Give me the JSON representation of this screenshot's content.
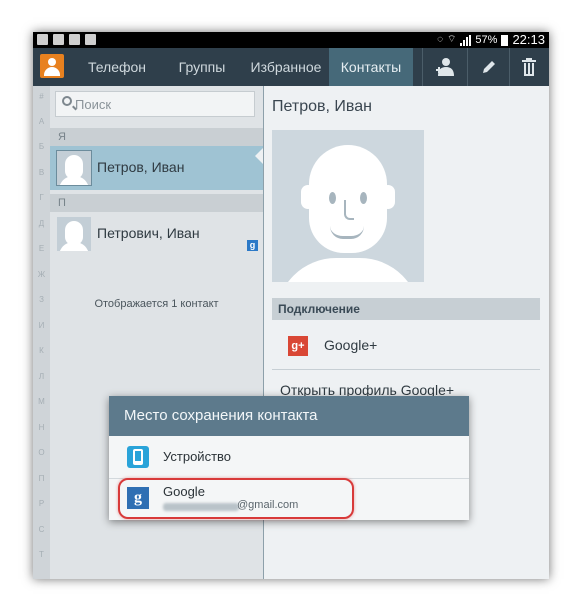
{
  "status_bar": {
    "battery": "57%",
    "time": "22:13"
  },
  "tabs": [
    {
      "label": "Телефон"
    },
    {
      "label": "Группы"
    },
    {
      "label": "Избранное"
    },
    {
      "label": "Контакты",
      "active": true
    }
  ],
  "actions": {
    "add_contact_icon": "add-contact-icon",
    "edit_icon": "pencil-icon",
    "delete_icon": "trash-icon"
  },
  "index_letters": [
    "#",
    "А",
    "Б",
    "В",
    "Г",
    "Д",
    "Е",
    "Ж",
    "З",
    "И",
    "К",
    "Л",
    "М",
    "Н",
    "О",
    "П",
    "Р",
    "С",
    "Т"
  ],
  "search": {
    "placeholder": "Поиск"
  },
  "list": {
    "sections": [
      {
        "letter": "Я",
        "contacts": [
          {
            "name": "Петров, Иван",
            "selected": true
          }
        ]
      },
      {
        "letter": "П",
        "contacts": [
          {
            "name": "Петрович, Иван",
            "badge": "g"
          }
        ]
      }
    ],
    "count_text": "Отображается 1 контакт"
  },
  "detail": {
    "name": "Петров, Иван",
    "connection_header": "Подключение",
    "gplus_label": "Google+",
    "gplus_icon_text": "g+",
    "open_profile": "Открыть профиль Google+"
  },
  "dialog": {
    "title": "Место сохранения контакта",
    "options": [
      {
        "label": "Устройство",
        "icon": "phone-icon"
      },
      {
        "label": "Google",
        "icon": "google-icon",
        "icon_text": "g",
        "account_suffix": "@gmail.com"
      }
    ]
  },
  "colors": {
    "action_bar": "#2f3f4b",
    "active_tab": "#466979",
    "selected_row": "#9fc3d3",
    "dialog_title": "#5d7a8c",
    "highlight": "#d83a3a"
  }
}
